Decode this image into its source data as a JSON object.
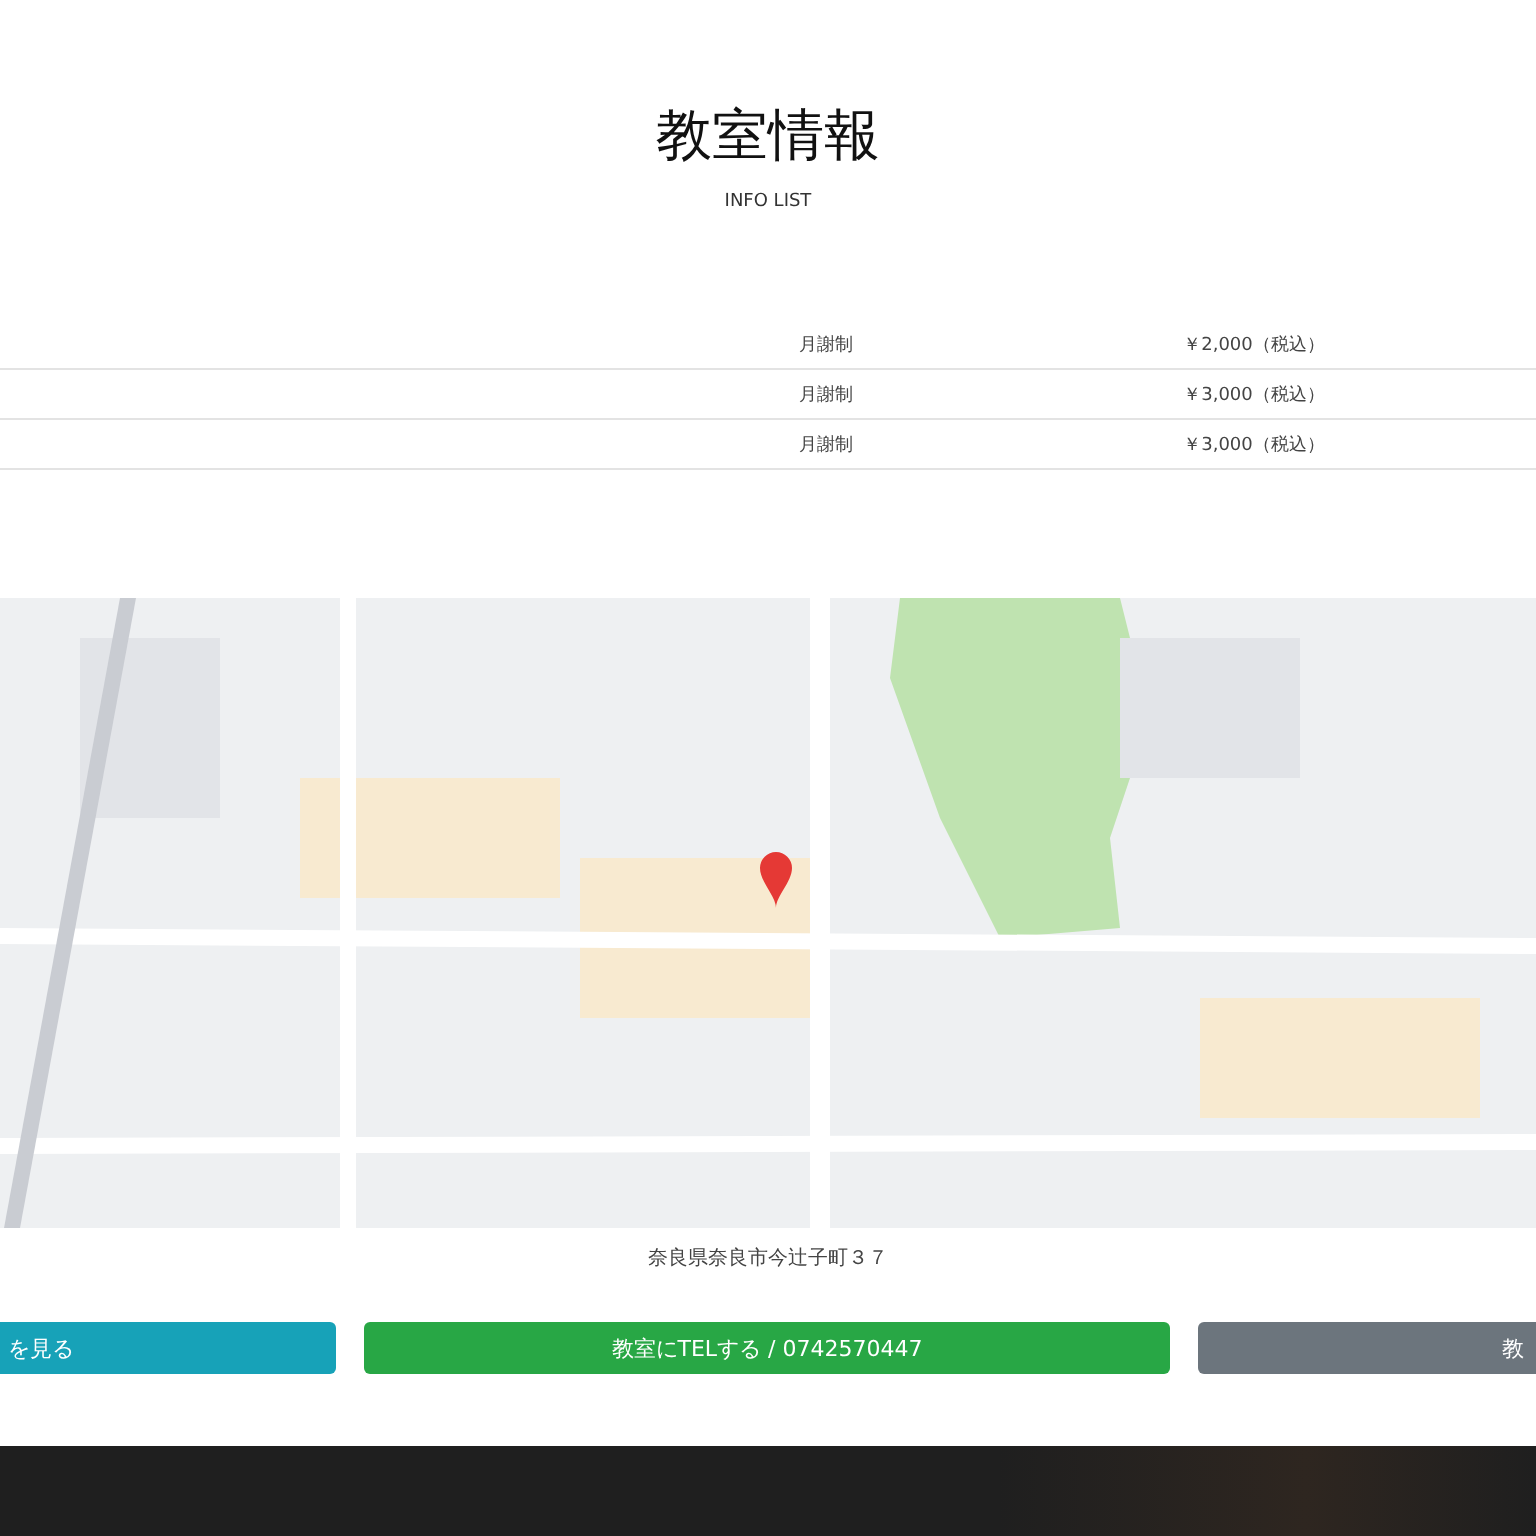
{
  "heading": {
    "title": "教室情報",
    "subtitle": "INFO LIST"
  },
  "fees": [
    {
      "plan": "月謝制",
      "price": "￥2,000（税込）"
    },
    {
      "plan": "月謝制",
      "price": "￥3,000（税込）"
    },
    {
      "plan": "月謝制",
      "price": "￥3,000（税込）"
    }
  ],
  "address": "奈良県奈良市今辻子町３７",
  "buttons": [
    {
      "label": "を見る",
      "kind": "info"
    },
    {
      "label": "教室にTELする / 0742570447",
      "kind": "call"
    },
    {
      "label": "教",
      "kind": "secondary"
    }
  ]
}
